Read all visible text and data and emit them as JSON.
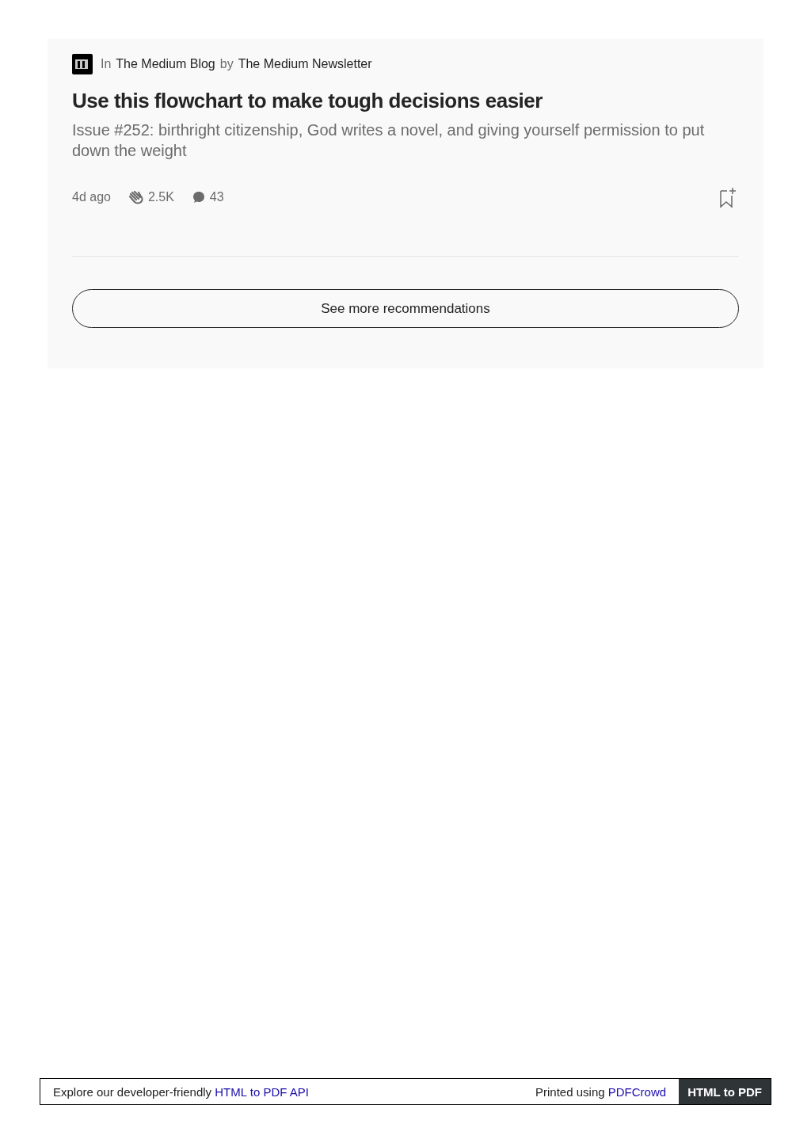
{
  "card": {
    "in_label": "In",
    "publication": "The Medium Blog",
    "by_label": "by",
    "author": "The Medium Newsletter",
    "title": "Use this flowchart to make tough decisions easier",
    "subtitle": "Issue #252: birthright citizenship, God writes a novel, and giving yourself permission to put down the weight",
    "age": "4d ago",
    "claps": "2.5K",
    "responses": "43",
    "button": "See more recommendations"
  },
  "footer": {
    "text": "Explore our developer-friendly ",
    "link": "HTML to PDF API",
    "printed": "Printed using ",
    "printed_link": "PDFCrowd",
    "badge": "HTML to PDF"
  }
}
